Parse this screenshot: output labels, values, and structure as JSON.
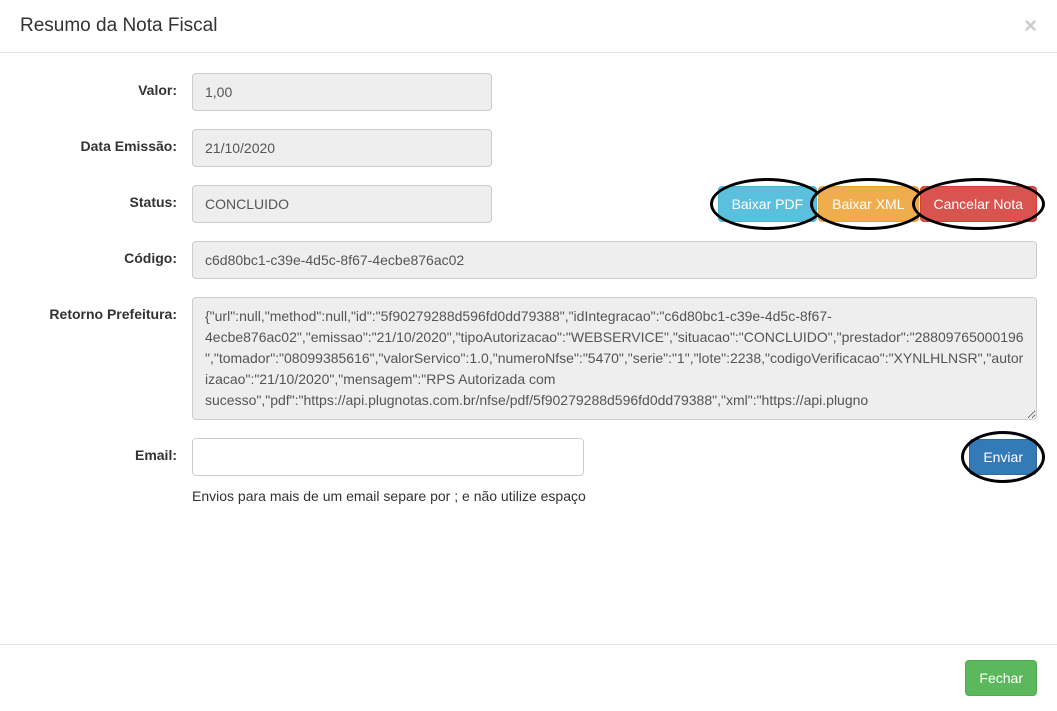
{
  "modal": {
    "title": "Resumo da Nota Fiscal"
  },
  "labels": {
    "valor": "Valor:",
    "data_emissao": "Data Emissão:",
    "status": "Status:",
    "codigo": "Código:",
    "retorno_prefeitura": "Retorno Prefeitura:",
    "email": "Email:"
  },
  "values": {
    "valor": "1,00",
    "data_emissao": "21/10/2020",
    "status": "CONCLUIDO",
    "codigo": "c6d80bc1-c39e-4d5c-8f67-4ecbe876ac02",
    "retorno_prefeitura": "{\"url\":null,\"method\":null,\"id\":\"5f90279288d596fd0dd79388\",\"idIntegracao\":\"c6d80bc1-c39e-4d5c-8f67-4ecbe876ac02\",\"emissao\":\"21/10/2020\",\"tipoAutorizacao\":\"WEBSERVICE\",\"situacao\":\"CONCLUIDO\",\"prestador\":\"28809765000196\",\"tomador\":\"08099385616\",\"valorServico\":1.0,\"numeroNfse\":\"5470\",\"serie\":\"1\",\"lote\":2238,\"codigoVerificacao\":\"XYNLHLNSR\",\"autorizacao\":\"21/10/2020\",\"mensagem\":\"RPS Autorizada com sucesso\",\"pdf\":\"https://api.plugnotas.com.br/nfse/pdf/5f90279288d596fd0dd79388\",\"xml\":\"https://api.plugno",
    "email": ""
  },
  "buttons": {
    "baixar_pdf": "Baixar PDF",
    "baixar_xml": "Baixar XML",
    "cancelar_nota": "Cancelar Nota",
    "enviar": "Enviar",
    "fechar": "Fechar"
  },
  "hints": {
    "email_hint": "Envios para mais de um email separe por ; e não utilize espaço"
  }
}
